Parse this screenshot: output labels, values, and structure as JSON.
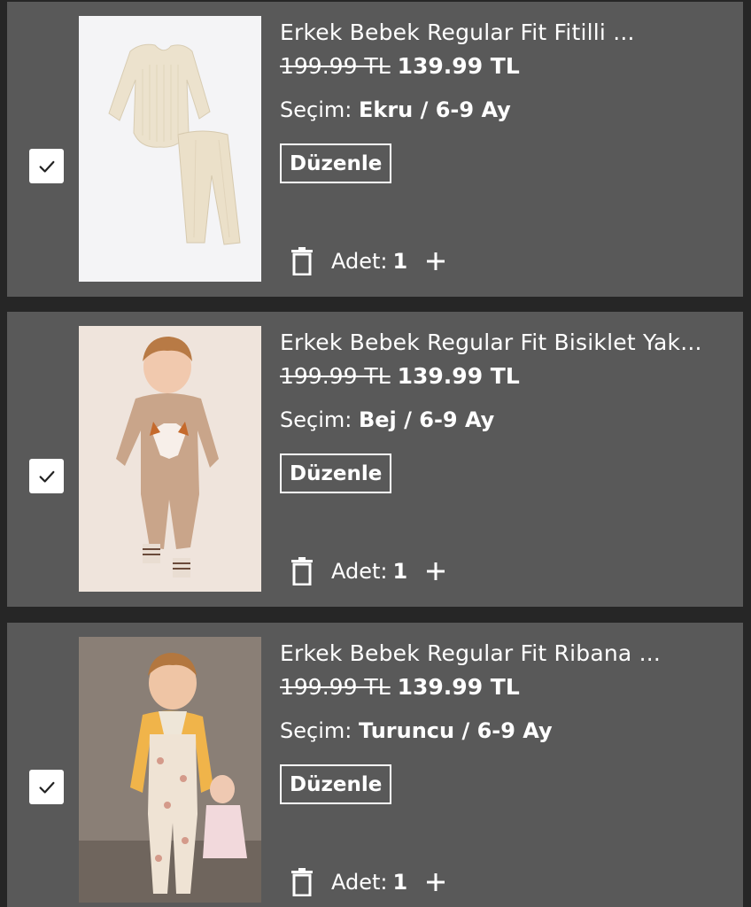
{
  "cart": {
    "items": [
      {
        "title": "Erkek Bebek Regular Fit Fitilli ...",
        "old_price": "199.99 TL",
        "new_price": "139.99 TL",
        "selection_label": "Seçim:",
        "selection_value": "Ekru / 6-9 Ay",
        "edit_label": "Düzenle",
        "qty_label": "Adet:",
        "qty_value": "1",
        "checked": true
      },
      {
        "title": "Erkek Bebek Regular Fit Bisiklet Yak...",
        "old_price": "199.99 TL",
        "new_price": "139.99 TL",
        "selection_label": "Seçim:",
        "selection_value": "Bej / 6-9 Ay",
        "edit_label": "Düzenle",
        "qty_label": "Adet:",
        "qty_value": "1",
        "checked": true
      },
      {
        "title": "Erkek Bebek Regular Fit Ribana ...",
        "old_price": "199.99 TL",
        "new_price": "139.99 TL",
        "selection_label": "Seçim:",
        "selection_value": "Turuncu / 6-9 Ay",
        "edit_label": "Düzenle",
        "qty_label": "Adet:",
        "qty_value": "1",
        "checked": true
      }
    ]
  },
  "icons": {
    "checkbox": "check-icon",
    "delete": "trash-icon",
    "increase": "plus-icon"
  },
  "colors": {
    "page_background": "#262626",
    "card_background": "#595959",
    "text": "#ffffff"
  }
}
